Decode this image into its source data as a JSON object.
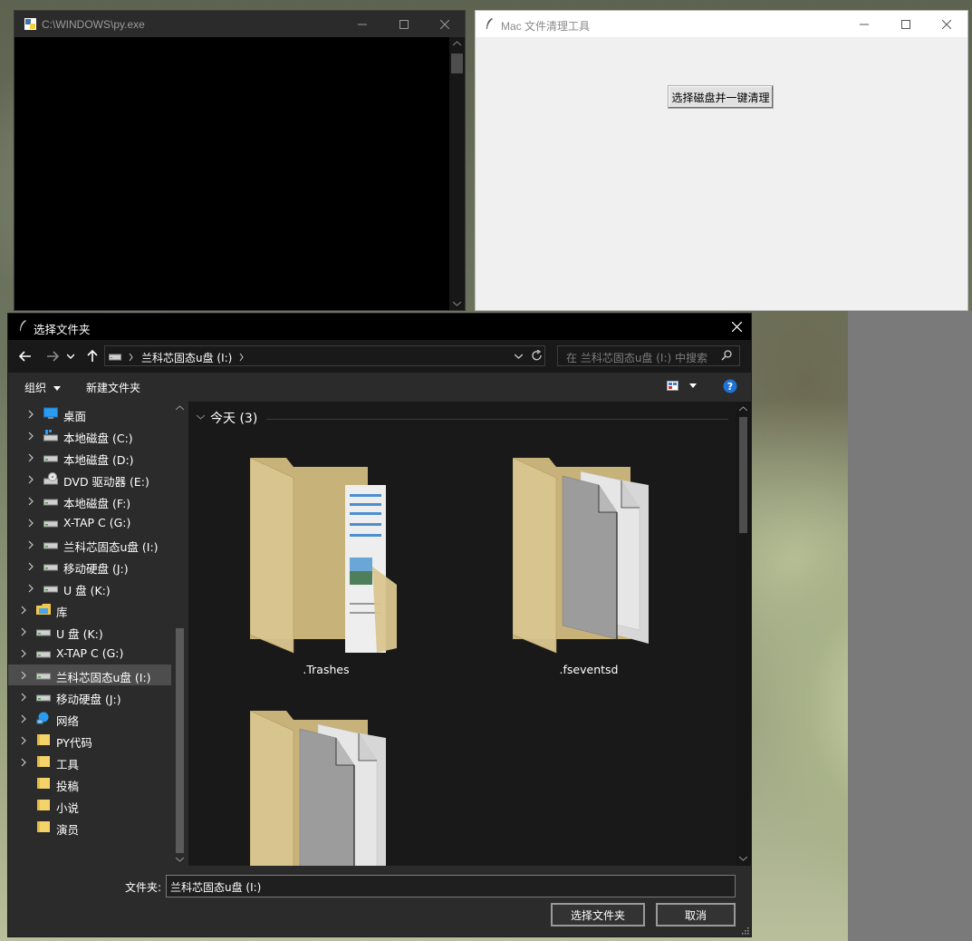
{
  "console": {
    "title": "C:\\WINDOWS\\py.exe"
  },
  "tk_window": {
    "title": "Mac 文件清理工具",
    "button_label": "选择磁盘并一键清理"
  },
  "dialog": {
    "title": "选择文件夹",
    "address_crumb": "兰科芯固态u盘 (I:)",
    "search_placeholder": "在 兰科芯固态u盘 (I:) 中搜索",
    "toolbar": {
      "organize": "组织",
      "new_folder": "新建文件夹"
    },
    "nav_tree": [
      {
        "label": "桌面",
        "icon": "desktop-icon"
      },
      {
        "label": "本地磁盘 (C:)",
        "icon": "system-drive-icon"
      },
      {
        "label": "本地磁盘 (D:)",
        "icon": "drive-icon"
      },
      {
        "label": "DVD 驱动器 (E:)",
        "icon": "dvd-drive-icon"
      },
      {
        "label": "本地磁盘 (F:)",
        "icon": "drive-icon"
      },
      {
        "label": "X-TAP C (G:)",
        "icon": "drive-icon"
      },
      {
        "label": "兰科芯固态u盘 (I:)",
        "icon": "drive-icon"
      },
      {
        "label": "移动硬盘 (J:)",
        "icon": "drive-icon"
      },
      {
        "label": "U 盘 (K:)",
        "icon": "drive-icon"
      },
      {
        "label": "库",
        "icon": "library-icon"
      },
      {
        "label": "U 盘 (K:)",
        "icon": "drive-icon"
      },
      {
        "label": "X-TAP C (G:)",
        "icon": "drive-icon"
      },
      {
        "label": "兰科芯固态u盘 (I:)",
        "icon": "drive-icon",
        "selected": true
      },
      {
        "label": "移动硬盘 (J:)",
        "icon": "drive-icon"
      },
      {
        "label": "网络",
        "icon": "network-icon"
      },
      {
        "label": "PY代码",
        "icon": "folder-icon"
      },
      {
        "label": "工具",
        "icon": "folder-icon"
      },
      {
        "label": "投稿",
        "icon": "folder-icon"
      },
      {
        "label": "小说",
        "icon": "folder-icon"
      },
      {
        "label": "演员",
        "icon": "folder-icon"
      }
    ],
    "group_header": "今天 (3)",
    "items": [
      {
        "name": ".Trashes"
      },
      {
        "name": ".fseventsd"
      },
      {
        "name": ""
      }
    ],
    "folder_label": "文件夹:",
    "folder_value": "兰科芯固态u盘 (I:)",
    "select_button": "选择文件夹",
    "cancel_button": "取消"
  },
  "colors": {
    "folder": "#d9c58f",
    "folder_back": "#c7b27a",
    "dialog_bg": "#2b2b2b",
    "content_bg": "#191919",
    "selected": "#4d4d4d"
  }
}
